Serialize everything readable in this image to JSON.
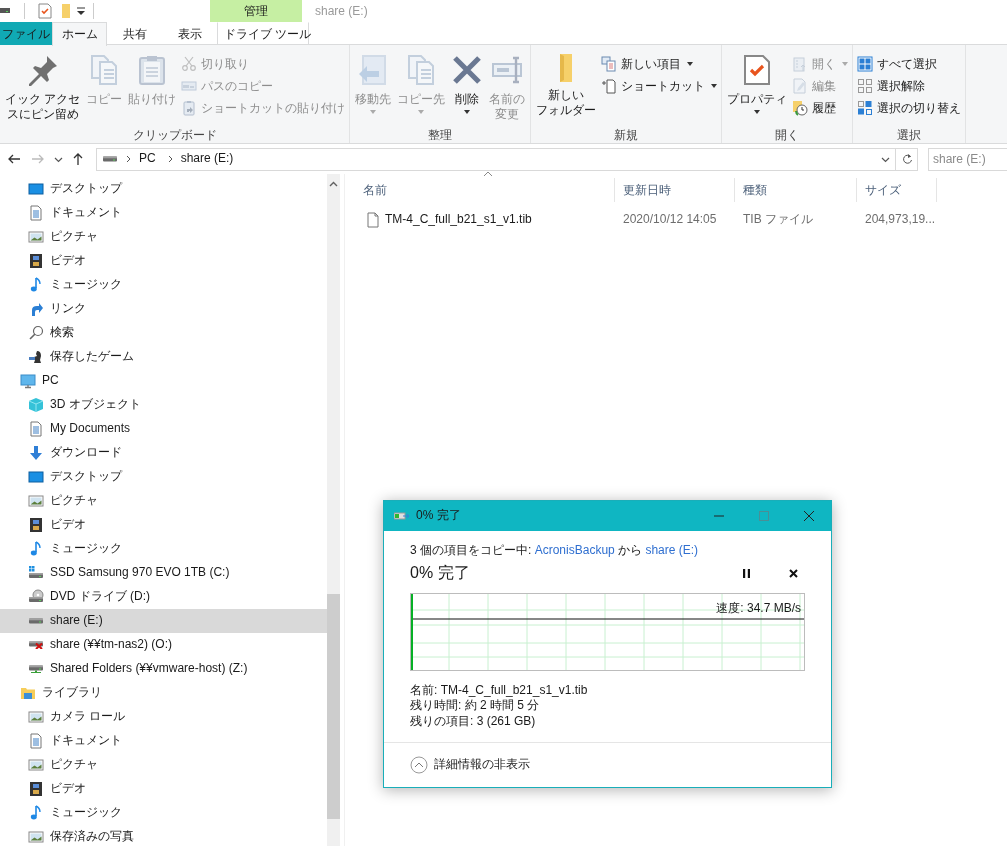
{
  "titlebar": {
    "context_label": "管理",
    "title": "share (E:)"
  },
  "tabs": [
    {
      "label": "ファイル",
      "kind": "file",
      "selected": false
    },
    {
      "label": "ホーム",
      "kind": "tab",
      "selected": true
    },
    {
      "label": "共有",
      "kind": "tab",
      "selected": false
    },
    {
      "label": "表示",
      "kind": "tab",
      "selected": false
    },
    {
      "label": "ドライブ ツール",
      "kind": "context",
      "selected": false
    }
  ],
  "ribbon": {
    "groups": [
      {
        "label": "クリップボード",
        "parts": [
          {
            "kind": "pin",
            "lines": [
              "イック アクセ",
              "スにピン留め"
            ],
            "disabled": false
          },
          {
            "kind": "copy",
            "lines": [
              "コピー"
            ],
            "disabled": true
          },
          {
            "kind": "paste",
            "lines": [
              "貼り付け"
            ],
            "disabled": true
          },
          {
            "buttons": [
              {
                "kind": "cut",
                "label": "切り取り",
                "disabled": true
              },
              {
                "kind": "copypath",
                "label": "パスのコピー",
                "disabled": true
              },
              {
                "kind": "pasteshortcut",
                "label": "ショートカットの貼り付け",
                "disabled": true
              }
            ]
          }
        ]
      },
      {
        "label": "整理",
        "parts": [
          {
            "kind": "move",
            "lines": [
              "移動先"
            ],
            "disabled": true,
            "dropdown": true
          },
          {
            "kind": "copyto",
            "lines": [
              "コピー先"
            ],
            "disabled": true,
            "dropdown": true
          },
          {
            "kind": "delete",
            "lines": [
              "削除"
            ],
            "disabled": false,
            "dropdown": true
          },
          {
            "kind": "rename",
            "lines": [
              "名前の",
              "変更"
            ],
            "disabled": true
          }
        ]
      },
      {
        "label": "新規",
        "parts": [
          {
            "kind": "newfolder",
            "lines": [
              "新しい",
              "フォルダー"
            ],
            "disabled": false
          },
          {
            "buttons": [
              {
                "kind": "newitem",
                "label": "新しい項目",
                "disabled": false,
                "dropdown": true
              },
              {
                "kind": "shortcut",
                "label": "ショートカット",
                "disabled": false,
                "dropdown": true
              }
            ]
          }
        ]
      },
      {
        "label": "開く",
        "parts": [
          {
            "kind": "properties",
            "lines": [
              "プロパティ"
            ],
            "disabled": false,
            "dropdown": true
          },
          {
            "buttons": [
              {
                "kind": "open",
                "label": "開く",
                "disabled": true,
                "dropdown": true
              },
              {
                "kind": "edit",
                "label": "編集",
                "disabled": true
              },
              {
                "kind": "history",
                "label": "履歴",
                "disabled": false
              }
            ]
          }
        ]
      },
      {
        "label": "選択",
        "parts": [
          {
            "buttons": [
              {
                "kind": "selectall",
                "label": "すべて選択",
                "disabled": false
              },
              {
                "kind": "selectnone",
                "label": "選択解除",
                "disabled": false
              },
              {
                "kind": "invert",
                "label": "選択の切り替え",
                "disabled": false
              }
            ]
          }
        ]
      }
    ]
  },
  "navigation": {
    "back": {
      "disabled": false
    },
    "forward": {
      "disabled": true
    },
    "breadcrumbs": [
      "PC",
      "share (E:)"
    ],
    "search": {
      "placeholder": "share (E:)"
    }
  },
  "sidebar": {
    "items": [
      {
        "children": [
          {
            "label": "デスクトップ",
            "kind": "desktop",
            "selected": false
          },
          {
            "label": "ドキュメント",
            "kind": "documents",
            "selected": false
          },
          {
            "label": "ピクチャ",
            "kind": "pictures",
            "selected": false
          },
          {
            "label": "ビデオ",
            "kind": "videos",
            "selected": false
          },
          {
            "label": "ミュージック",
            "kind": "music",
            "selected": false
          },
          {
            "label": "リンク",
            "kind": "links",
            "selected": false
          },
          {
            "label": "検索",
            "kind": "search",
            "selected": false
          },
          {
            "label": "保存したゲーム",
            "kind": "games",
            "selected": false
          }
        ]
      },
      {
        "label": "PC",
        "kind": "pc",
        "selected": false,
        "children": [
          {
            "label": "3D オブジェクト",
            "kind": "objects3d",
            "selected": false
          },
          {
            "label": "My Documents",
            "kind": "documents",
            "selected": false
          },
          {
            "label": "ダウンロード",
            "kind": "downloads",
            "selected": false
          },
          {
            "label": "デスクトップ",
            "kind": "desktop",
            "selected": false
          },
          {
            "label": "ピクチャ",
            "kind": "pictures",
            "selected": false
          },
          {
            "label": "ビデオ",
            "kind": "videos",
            "selected": false
          },
          {
            "label": "ミュージック",
            "kind": "music",
            "selected": false
          },
          {
            "label": "SSD Samsung 970 EVO 1TB (C:)",
            "kind": "system_drive",
            "selected": false
          },
          {
            "label": "DVD ドライブ (D:)",
            "kind": "dvd",
            "selected": false
          },
          {
            "label": "share (E:)",
            "kind": "drive",
            "selected": true
          },
          {
            "label": "share (¥¥tm-nas2) (O:)",
            "kind": "network_offline",
            "selected": false
          },
          {
            "label": "Shared Folders (¥¥vmware-host) (Z:)",
            "kind": "network",
            "selected": false
          }
        ]
      },
      {
        "label": "ライブラリ",
        "kind": "library",
        "selected": false,
        "children": [
          {
            "label": "カメラ ロール",
            "kind": "pictures",
            "selected": false
          },
          {
            "label": "ドキュメント",
            "kind": "documents",
            "selected": false
          },
          {
            "label": "ピクチャ",
            "kind": "pictures",
            "selected": false
          },
          {
            "label": "ビデオ",
            "kind": "videos",
            "selected": false
          },
          {
            "label": "ミュージック",
            "kind": "music",
            "selected": false
          },
          {
            "label": "保存済みの写真",
            "kind": "pictures",
            "selected": false
          }
        ]
      }
    ]
  },
  "file_list": {
    "columns": [
      {
        "label": "名前",
        "sorted": true
      },
      {
        "label": "更新日時"
      },
      {
        "label": "種類"
      },
      {
        "label": "サイズ"
      }
    ],
    "rows": [
      {
        "cells": [
          "TM-4_C_full_b21_s1_v1.tib",
          "2020/10/12 14:05",
          "TIB ファイル",
          "204,973,19..."
        ]
      }
    ]
  },
  "dialog": {
    "title": "0% 完了",
    "status": [
      {
        "text": "3 個の項目をコピー中: ",
        "link": false
      },
      {
        "text": "AcronisBackup",
        "link": true
      },
      {
        "text": " から ",
        "link": false
      },
      {
        "text": "share (E:)",
        "link": true
      }
    ],
    "heading": "0% 完了",
    "speed": "速度: 34.7 MB/s",
    "details": [
      "名前: TM-4_C_full_b21_s1_v1.tib",
      "残り時間: 約 2 時間 5 分",
      "残りの項目: 3 (261 GB)"
    ],
    "toggle": "詳細情報の非表示"
  }
}
